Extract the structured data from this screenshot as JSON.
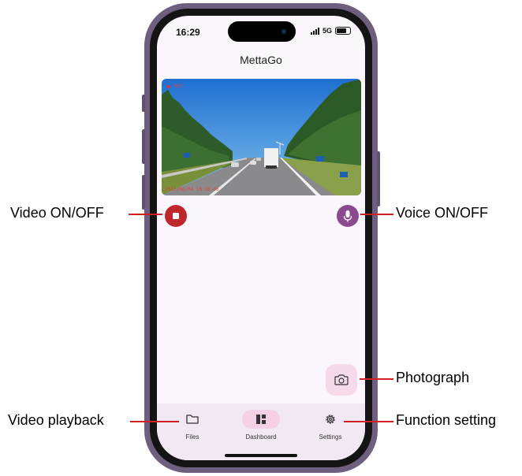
{
  "status_bar": {
    "time": "16:29",
    "network": "5G"
  },
  "app": {
    "title": "MettaGo"
  },
  "video": {
    "rec_label": "REC",
    "timestamp": "2023/08/04 16:28:46"
  },
  "controls": {
    "record_icon": "stop-square-icon",
    "voice_icon": "microphone-icon",
    "photo_icon": "camera-icon"
  },
  "nav": {
    "items": [
      {
        "label": "Files",
        "icon": "folder-icon"
      },
      {
        "label": "Dashboard",
        "icon": "dashboard-icon",
        "selected": true
      },
      {
        "label": "Settings",
        "icon": "gear-icon"
      }
    ]
  },
  "annotations": {
    "video": "Video ON/OFF",
    "voice": "Voice ON/OFF",
    "photo": "Photograph",
    "playback": "Video playback",
    "settings": "Function setting"
  },
  "colors": {
    "record": "#c0272d",
    "voice": "#8b4a8f",
    "photo_bg": "#f7d9ec",
    "nav_bg": "#f2e8f3",
    "nav_selected": "#f6d0e6",
    "leader": "#d02020"
  }
}
